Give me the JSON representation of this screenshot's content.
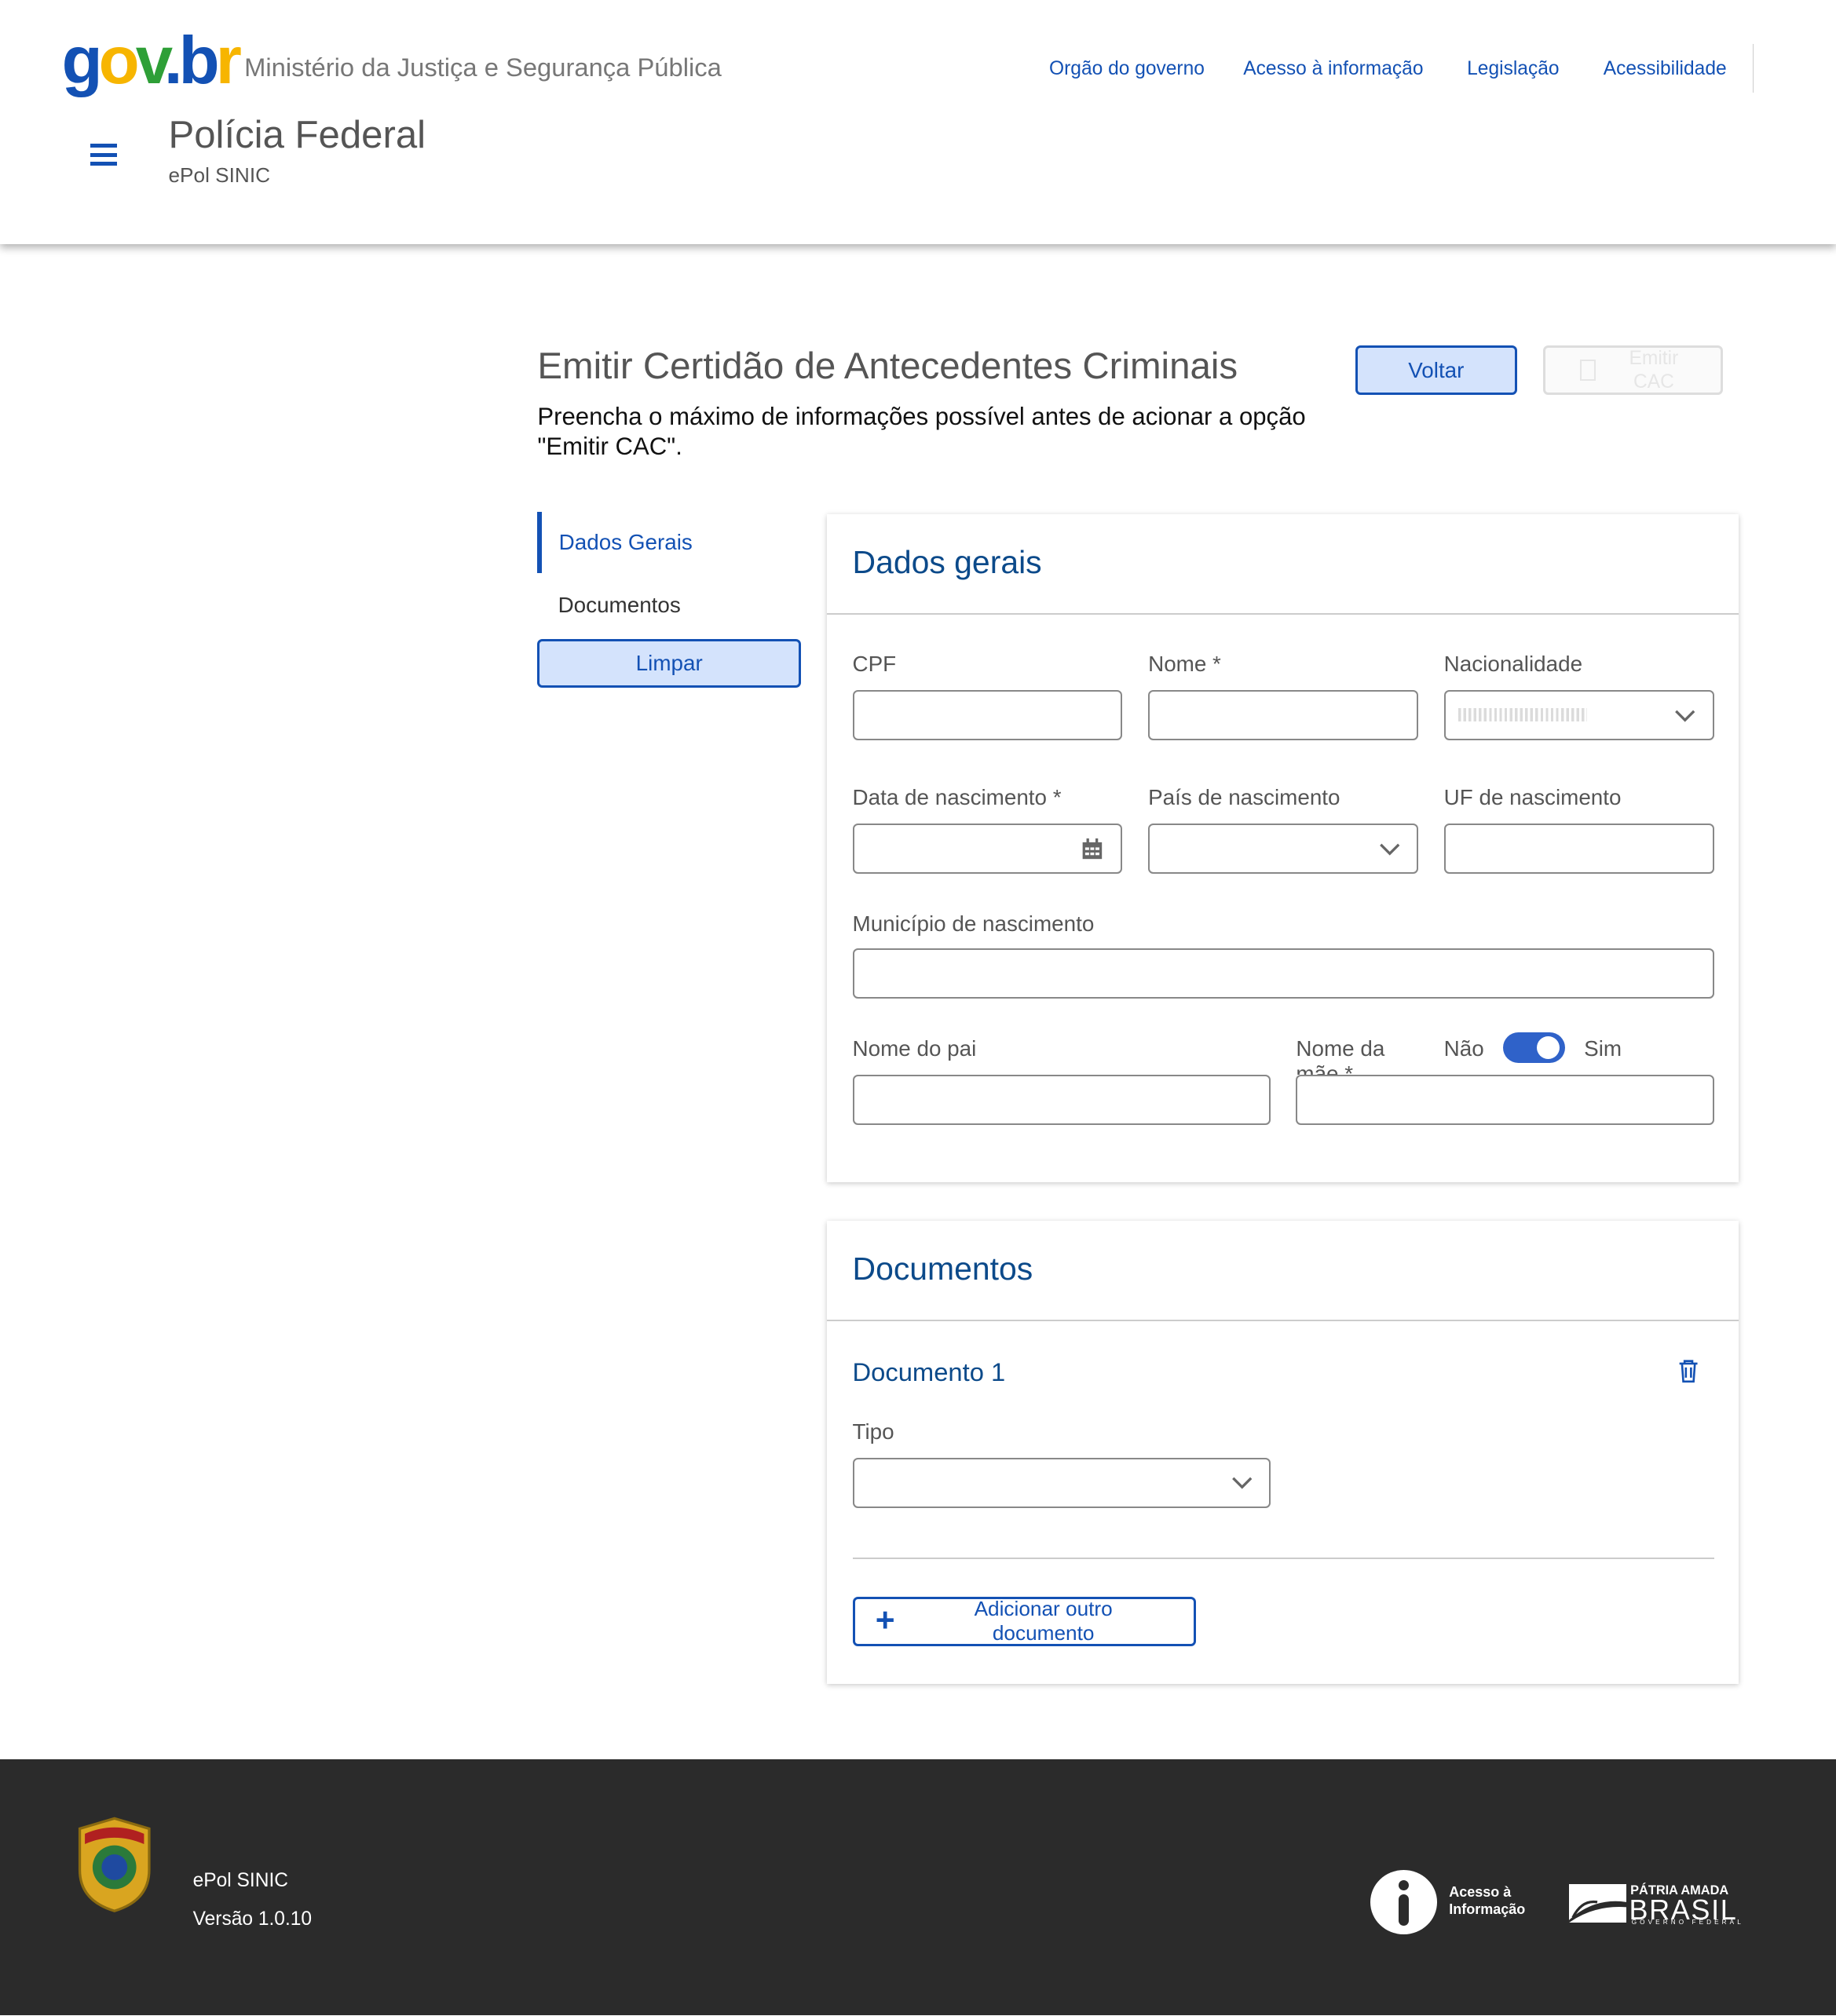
{
  "header": {
    "logo_text": "gov.br",
    "ministry": "Ministério da Justiça e Segurança Pública",
    "nav": [
      "Orgão do governo",
      "Acesso à informação",
      "Legislação",
      "Acessibilidade"
    ],
    "title": "Polícia Federal",
    "subtitle": "ePol SINIC"
  },
  "page": {
    "title": "Emitir Certidão de Antecedentes Criminais",
    "description": "Preencha o máximo de informações possível antes de acionar a opção \"Emitir CAC\".",
    "back_label": "Voltar",
    "emit_label": "Emitir CAC"
  },
  "sidenav": {
    "items": [
      {
        "label": "Dados Gerais",
        "active": true
      },
      {
        "label": "Documentos",
        "active": false
      }
    ],
    "clear_label": "Limpar"
  },
  "dados_gerais": {
    "title": "Dados gerais",
    "cpf_label": "CPF",
    "nome_label": "Nome *",
    "nacionalidade_label": "Nacionalidade",
    "data_nasc_label": "Data de nascimento *",
    "pais_nasc_label": "País de nascimento",
    "uf_nasc_label": "UF de nascimento",
    "municipio_label": "Município de nascimento",
    "pai_label": "Nome do pai",
    "mae_label": "Nome da mãe *",
    "toggle_no": "Não",
    "toggle_yes": "Sim",
    "toggle_on": true
  },
  "documentos": {
    "title": "Documentos",
    "doc_title": "Documento 1",
    "tipo_label": "Tipo",
    "add_label": "Adicionar outro documento"
  },
  "footer": {
    "app": "ePol SINIC",
    "version": "Versão 1.0.10",
    "access_info": "Acesso à Informação",
    "brand_top": "PÁTRIA AMADA",
    "brand_main": "BRASIL",
    "brand_bottom": "GOVERNO FEDERAL"
  },
  "colors": {
    "primary": "#1351b4",
    "heading": "#0c4a8a",
    "footer_bg": "#2b2b2b",
    "toggle": "#2f62c9"
  }
}
